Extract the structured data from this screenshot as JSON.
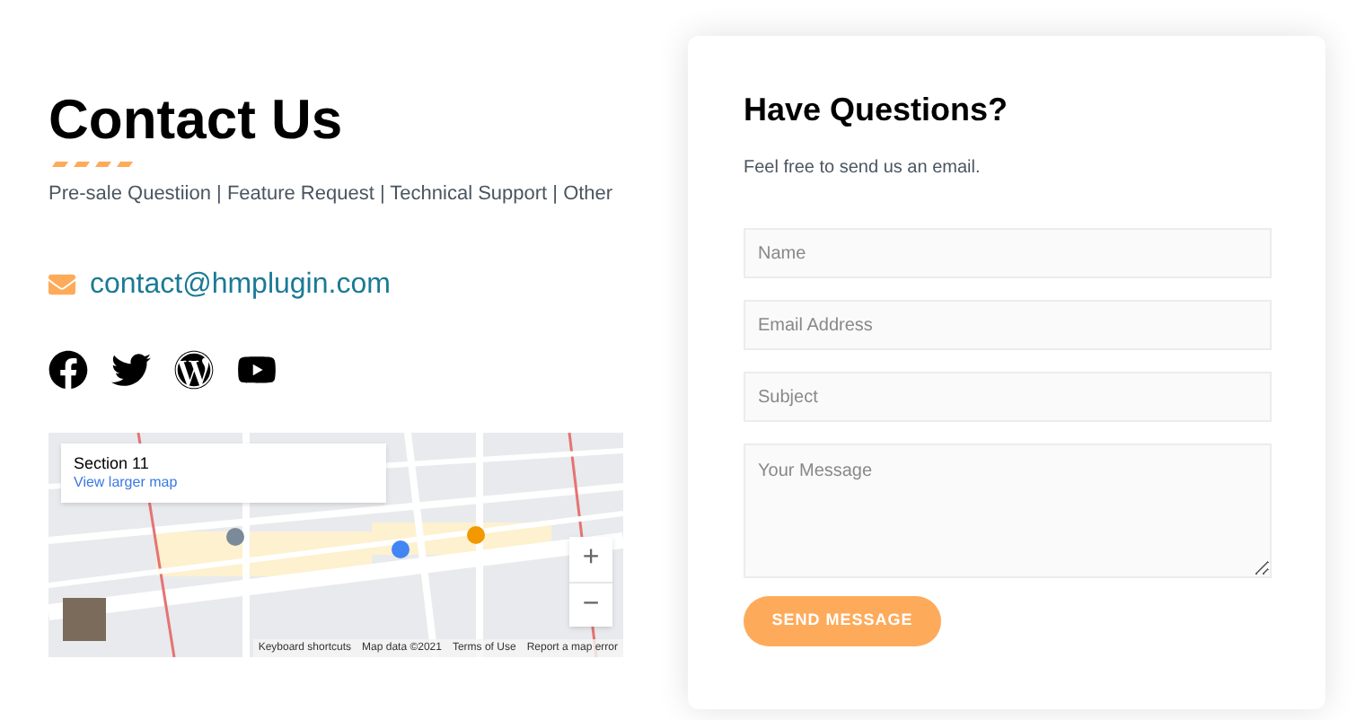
{
  "contact": {
    "title": "Contact Us",
    "topics": "Pre-sale Questiion | Feature Request | Technical Support | Other",
    "email": "contact@hmplugin.com",
    "social": [
      {
        "kind": "facebook"
      },
      {
        "kind": "twitter"
      },
      {
        "kind": "wordpress"
      },
      {
        "kind": "youtube"
      }
    ]
  },
  "map": {
    "place": "Section 11",
    "link": "View larger map",
    "zoom_in": "+",
    "zoom_out": "−",
    "footer": [
      "Keyboard shortcuts",
      "Map data ©2021",
      "Terms of Use",
      "Report a map error"
    ]
  },
  "form": {
    "title": "Have Questions?",
    "subtitle": "Feel free to send us an email.",
    "fields": [
      {
        "placeholder": "Name",
        "kind": "text"
      },
      {
        "placeholder": "Email Address",
        "kind": "text"
      },
      {
        "placeholder": "Subject",
        "kind": "text"
      },
      {
        "placeholder": "Your Message",
        "kind": "textarea"
      }
    ],
    "button": "SEND MESSAGE"
  }
}
